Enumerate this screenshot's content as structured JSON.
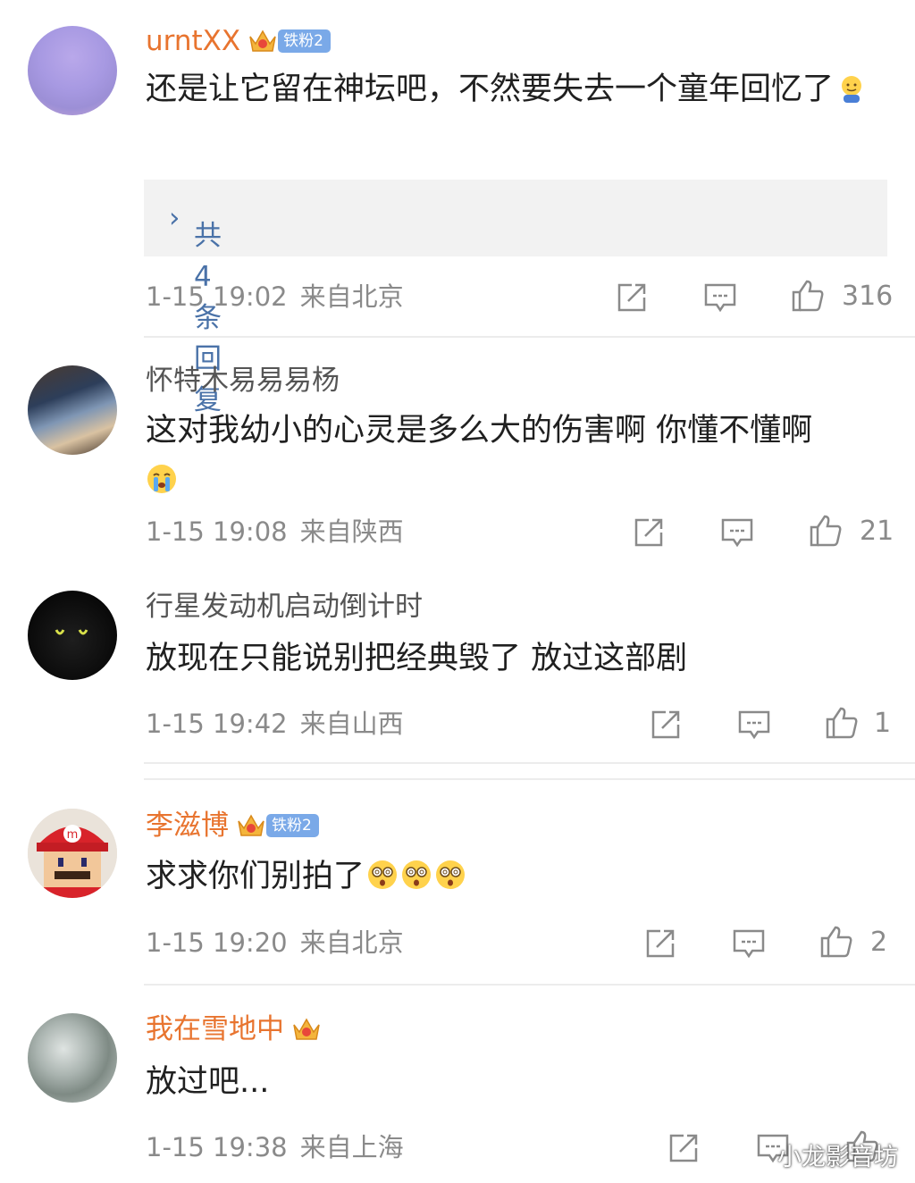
{
  "comments": [
    {
      "username": "urntXX",
      "fan_badge": "铁粉2",
      "text": "还是让它留在神坛吧，不然要失去一个童年回忆了",
      "replies_label": "共4条回复",
      "time": "1-15 19:02",
      "location": "来自北京",
      "likes": "316"
    },
    {
      "username": "怀特木易易易杨",
      "text": "这对我幼小的心灵是多么大的伤害啊 你懂不懂啊",
      "time": "1-15 19:08",
      "location": "来自陕西",
      "likes": "21"
    },
    {
      "username": "行星发动机启动倒计时",
      "text": "放现在只能说别把经典毁了 放过这部剧",
      "time": "1-15 19:42",
      "location": "来自山西",
      "likes": "1"
    },
    {
      "username": "李滋博",
      "fan_badge": "铁粉2",
      "text": "求求你们别拍了",
      "time": "1-15 19:20",
      "location": "来自北京",
      "likes": "2"
    },
    {
      "username": "我在雪地中",
      "text": "放过吧...",
      "time": "1-15 19:38",
      "location": "来自上海",
      "likes": ""
    }
  ],
  "watermark": "小龙影音坊",
  "colors": {
    "vip_name": "#e8742f",
    "reply_link": "#4a72a8",
    "meta": "#8a8a8a",
    "fan_badge": "#7aa9e8"
  },
  "icons": [
    "repost-icon",
    "comment-icon",
    "like-icon",
    "crown-icon"
  ]
}
